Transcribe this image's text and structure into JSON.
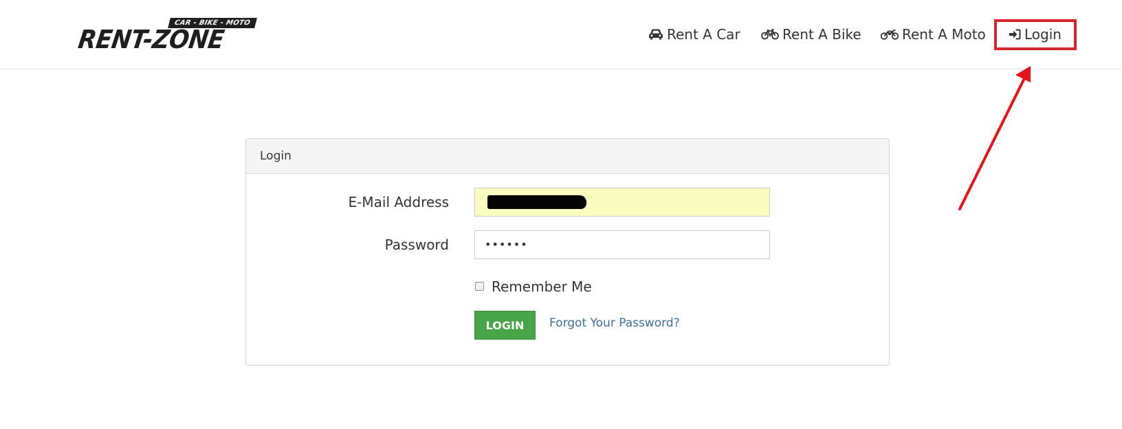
{
  "brand": {
    "tagline": "CAR - BIKE - MOTO",
    "name": "RENT-ZONE"
  },
  "nav": {
    "items": [
      {
        "label": "Rent A Car",
        "icon": "car-icon"
      },
      {
        "label": "Rent A Bike",
        "icon": "bicycle-icon"
      },
      {
        "label": "Rent A Moto",
        "icon": "motorcycle-icon"
      },
      {
        "label": "Login",
        "icon": "sign-in-icon"
      }
    ]
  },
  "annotation": {
    "highlight_color": "#d7252e"
  },
  "login_panel": {
    "heading": "Login",
    "email_label": "E-Mail Address",
    "email_value": "",
    "password_label": "Password",
    "password_value": "••••••",
    "remember_label": "Remember Me",
    "remember_checked": false,
    "submit_label": "LOGIN",
    "forgot_label": "Forgot Your Password?"
  },
  "colors": {
    "button_green": "#47a447",
    "autofill_yellow": "#fafdc0",
    "link_blue": "#3f6f9a"
  }
}
